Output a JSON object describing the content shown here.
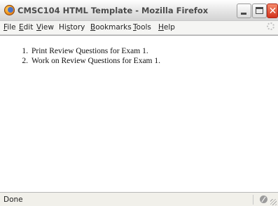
{
  "window": {
    "title": "CMSC104 HTML Template - Mozilla Firefox"
  },
  "menubar": {
    "items": [
      {
        "label": "File",
        "access_key": "F"
      },
      {
        "label": "Edit",
        "access_key": "E"
      },
      {
        "label": "View",
        "access_key": "V"
      },
      {
        "label": "History",
        "access_key": "s"
      },
      {
        "label": "Bookmarks",
        "access_key": "B"
      },
      {
        "label": "Tools",
        "access_key": "T"
      },
      {
        "label": "Help",
        "access_key": "H"
      }
    ]
  },
  "page": {
    "list": [
      {
        "number": "1.",
        "text": "Print Review Questions for Exam 1."
      },
      {
        "number": "2.",
        "text": "Work on Review Questions for Exam 1."
      }
    ]
  },
  "status": {
    "text": "Done"
  },
  "colors": {
    "close_button": "#d2321b",
    "title_text": "#4b4b4b"
  },
  "icons": {
    "app": "firefox-icon",
    "throbber": "throbber-icon",
    "status": "security-status-icon"
  }
}
